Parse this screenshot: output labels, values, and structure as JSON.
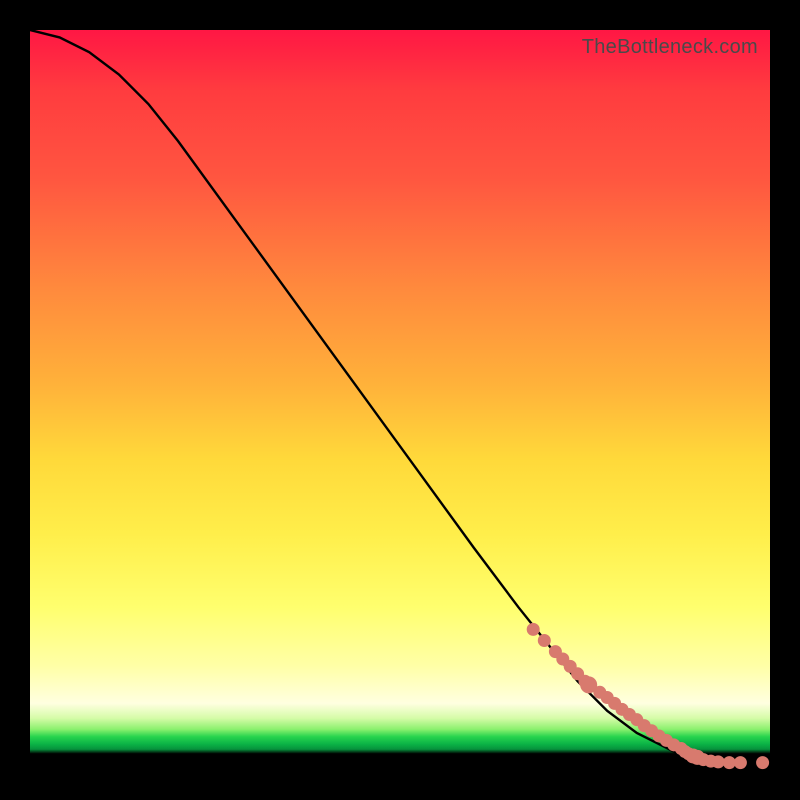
{
  "watermark": "TheBottleneck.com",
  "colors": {
    "marker_fill": "#d87a6e",
    "marker_stroke": "#d87a6e",
    "curve": "#000000"
  },
  "chart_data": {
    "type": "line",
    "title": "",
    "xlabel": "",
    "ylabel": "",
    "xlim": [
      0,
      100
    ],
    "ylim": [
      0,
      100
    ],
    "curve": {
      "x": [
        0,
        4,
        8,
        12,
        16,
        20,
        28,
        36,
        44,
        52,
        60,
        66,
        70,
        74,
        78,
        82,
        86,
        88,
        90,
        92,
        94,
        96,
        98,
        100
      ],
      "y": [
        100,
        99,
        97,
        94,
        90,
        85,
        74,
        63,
        52,
        41,
        30,
        22,
        17,
        12,
        8,
        5,
        3,
        2,
        1.5,
        1.2,
        1.0,
        1.0,
        1.0,
        1.0
      ]
    },
    "markers": {
      "x": [
        68,
        69.5,
        71,
        72,
        73,
        74,
        75,
        75.5,
        77,
        78,
        79,
        80,
        81,
        82,
        83,
        84,
        85,
        86,
        87,
        88,
        88.5,
        89,
        89.6,
        90.2,
        91,
        92,
        93,
        94.5,
        96,
        99
      ],
      "y": [
        19,
        17.5,
        16,
        15,
        14,
        13,
        12,
        11.5,
        10.5,
        9.8,
        9.0,
        8.2,
        7.5,
        6.8,
        6.0,
        5.3,
        4.6,
        4.0,
        3.4,
        2.9,
        2.5,
        2.2,
        1.9,
        1.7,
        1.4,
        1.2,
        1.1,
        1.0,
        1.0,
        1.0
      ],
      "r": [
        6,
        6,
        6,
        6,
        6,
        6,
        6,
        8,
        6,
        6,
        6,
        6,
        6,
        6,
        6,
        6,
        6,
        6,
        6,
        6,
        6,
        6,
        7,
        7,
        6,
        6,
        6,
        6,
        6,
        6
      ]
    }
  }
}
